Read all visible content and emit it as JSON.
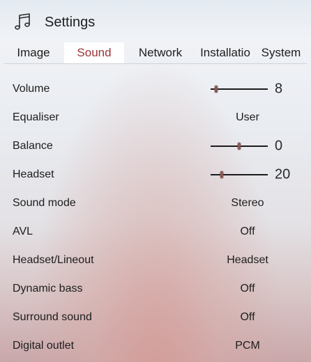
{
  "header": {
    "title": "Settings",
    "icon": "music-note-icon"
  },
  "tabs": [
    {
      "label": "Image",
      "active": false
    },
    {
      "label": "Sound",
      "active": true
    },
    {
      "label": "Network",
      "active": false
    },
    {
      "label": "Installatio",
      "active": false
    },
    {
      "label": "System",
      "active": false
    }
  ],
  "settings": {
    "volume": {
      "label": "Volume",
      "value": "8",
      "level": 0.1
    },
    "equaliser": {
      "label": "Equaliser",
      "value": "User"
    },
    "balance": {
      "label": "Balance",
      "value": "0",
      "level": 0.5
    },
    "headset": {
      "label": "Headset",
      "value": "20",
      "level": 0.2
    },
    "sound_mode": {
      "label": "Sound mode",
      "value": "Stereo"
    },
    "avl": {
      "label": "AVL",
      "value": "Off"
    },
    "headset_lineout": {
      "label": "Headset/Lineout",
      "value": "Headset"
    },
    "dynamic_bass": {
      "label": "Dynamic bass",
      "value": "Off"
    },
    "surround_sound": {
      "label": "Surround sound",
      "value": "Off"
    },
    "digital_outlet": {
      "label": "Digital outlet",
      "value": "PCM"
    }
  },
  "colors": {
    "active_tab_text": "#9a3336",
    "active_tab_bg": "#ffffff"
  }
}
